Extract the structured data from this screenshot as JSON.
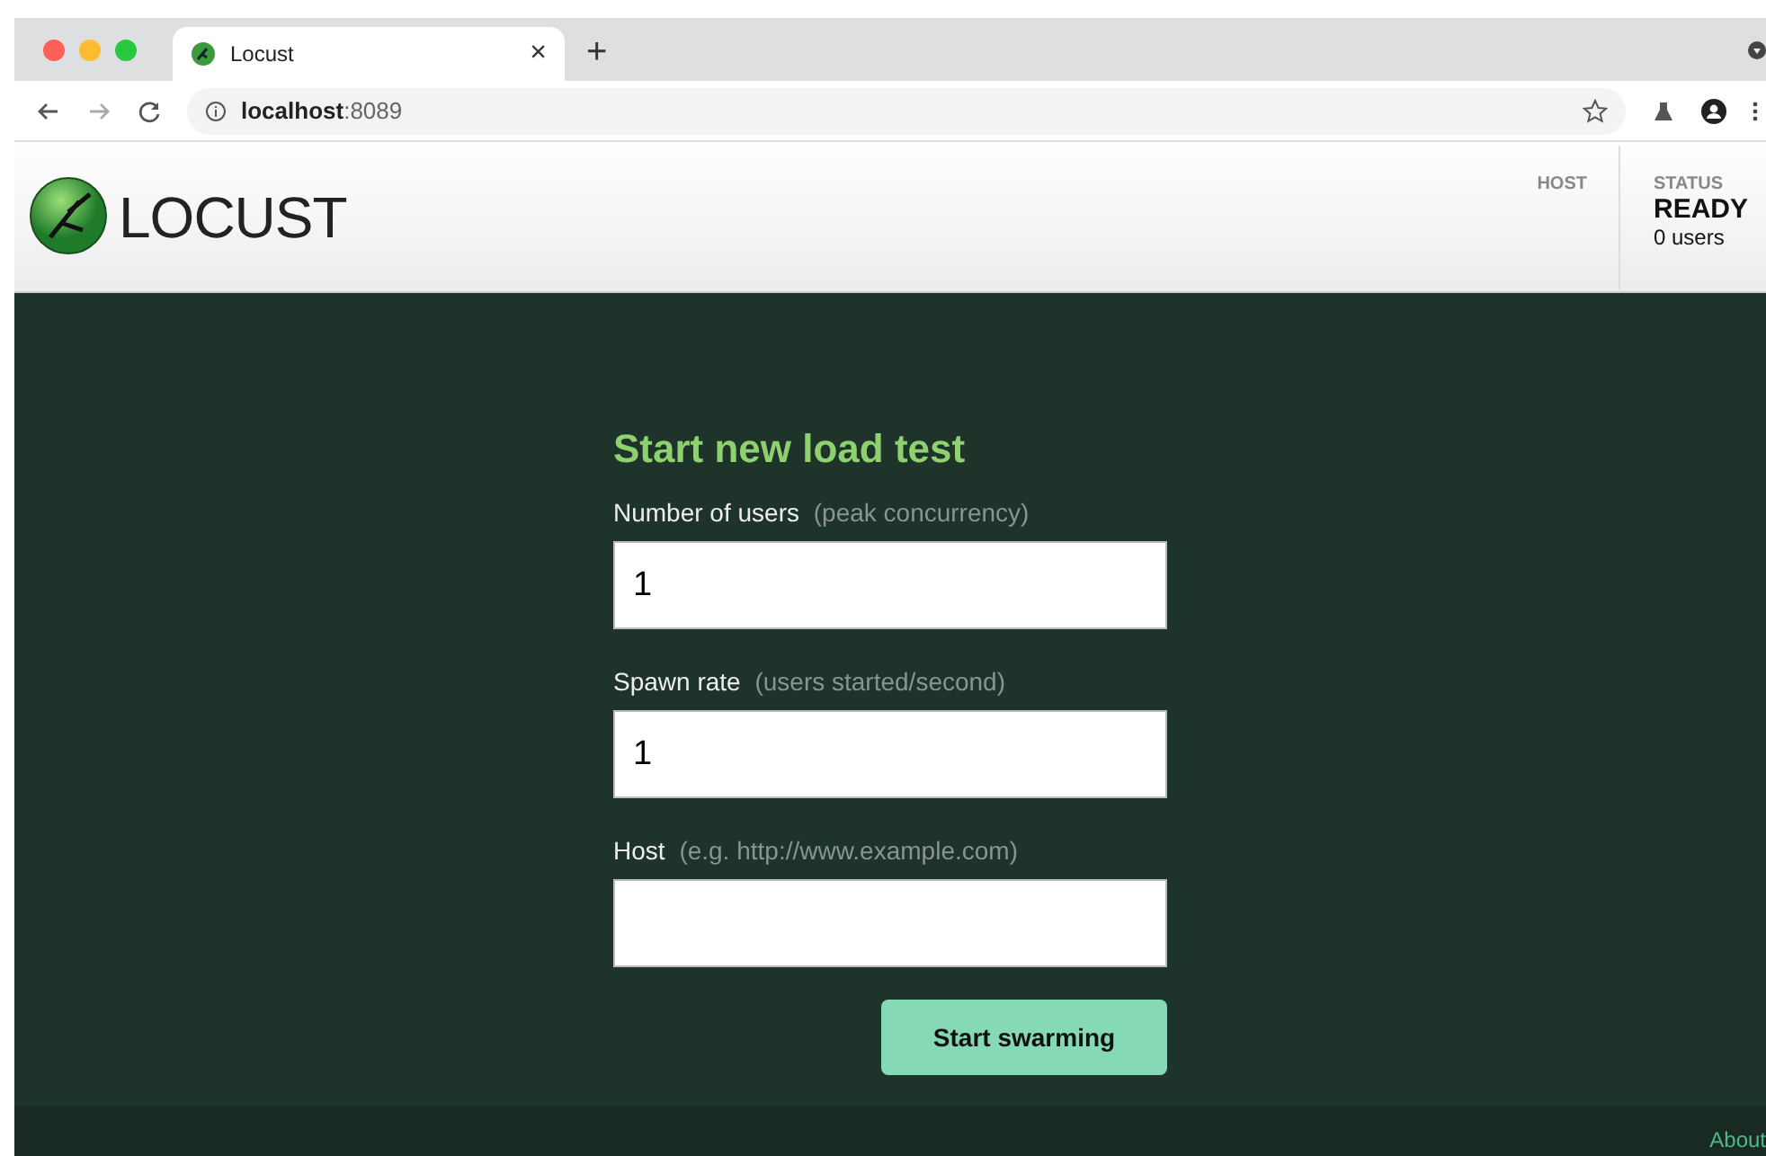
{
  "browser": {
    "tab": {
      "title": "Locust"
    },
    "new_tab": "+",
    "tab_close": "×",
    "address": {
      "host": "localhost",
      "port": ":8089"
    }
  },
  "header": {
    "logo_text": "LOCUST",
    "host": {
      "label": "HOST"
    },
    "status": {
      "label": "STATUS",
      "value": "READY",
      "users": "0 users"
    }
  },
  "form": {
    "title": "Start new load test",
    "fields": [
      {
        "label": "Number of users",
        "hint": "(peak concurrency)",
        "value": "1"
      },
      {
        "label": "Spawn rate",
        "hint": "(users started/second)",
        "value": "1"
      },
      {
        "label": "Host",
        "hint": "(e.g. http://www.example.com)"
      }
    ],
    "submit": "Start swarming"
  },
  "footer": {
    "link": "About"
  }
}
